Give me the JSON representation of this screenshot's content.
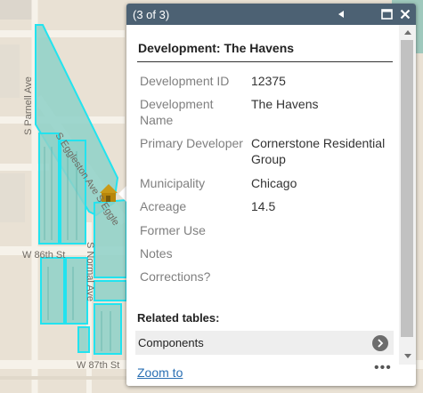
{
  "map": {
    "streets": {
      "parnell": "S Parnell Ave",
      "eggleston": "S Eggleston Ave S Eggle",
      "w86th": "W 86th St",
      "normal": "S Normal Ave",
      "w87th": "W 87th St"
    },
    "colors": {
      "parcel_fill": "#8ed1c8",
      "parcel_outline": "#22e3ef",
      "marker": "#c99a18"
    },
    "marker_icon": "house-marker-icon"
  },
  "popup": {
    "counter": "(3 of 3)",
    "header_color": "#4c6173",
    "icons": {
      "prev": "triangle-left-icon",
      "maximize": "maximize-icon",
      "close": "close-icon"
    },
    "title": "Development: The Havens",
    "attributes": [
      {
        "label": "Development ID",
        "value": "12375"
      },
      {
        "label": "Development Name",
        "value": "The Havens"
      },
      {
        "label": "Primary Developer",
        "value": "Cornerstone Residential Group"
      },
      {
        "label": "Municipality",
        "value": "Chicago"
      },
      {
        "label": "Acreage",
        "value": "14.5"
      },
      {
        "label": "Former Use",
        "value": ""
      },
      {
        "label": "Notes",
        "value": ""
      },
      {
        "label": "Corrections?",
        "value": ""
      }
    ],
    "related_title": "Related tables:",
    "related": [
      {
        "label": "Components"
      }
    ],
    "zoom_label": "Zoom to",
    "more_label": "•••"
  }
}
